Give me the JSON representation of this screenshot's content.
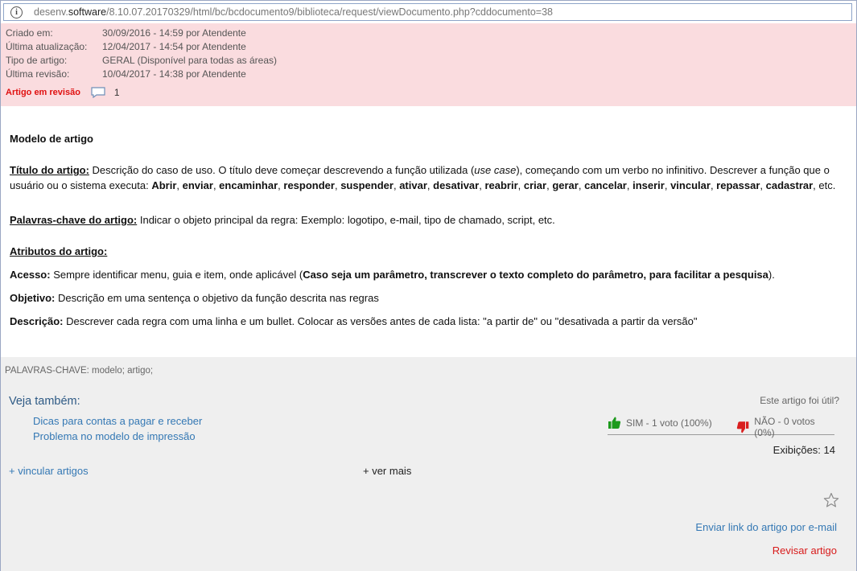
{
  "urlbar": {
    "prefix": "desenv.",
    "domain": "software",
    "path": "/8.10.07.20170329/html/bc/bcdocumento9/biblioteca/request/viewDocumento.php?cddocumento=38"
  },
  "meta": {
    "rows": [
      {
        "label": "Criado em:",
        "value": "30/09/2016 - 14:59 por Atendente"
      },
      {
        "label": "Última atualização:",
        "value": "12/04/2017 - 14:54 por Atendente"
      },
      {
        "label": "Tipo de artigo:",
        "value": "GERAL (Disponível para todas as áreas)"
      },
      {
        "label": "Última revisão:",
        "value": "10/04/2017 - 14:38 por Atendente"
      }
    ],
    "status": "Artigo em revisão",
    "comment_count": "1"
  },
  "article": {
    "heading": "Modelo de artigo",
    "titulo_label": "Título do artigo:",
    "titulo_p1": " Descrição do caso de uso. O título deve começar descrevendo a função utilizada (",
    "titulo_em": "use case",
    "titulo_p2": "), começando com um verbo no infinitivo. Descrever a função que o",
    "titulo_l2a": "usuário ou o sistema executa: ",
    "verbs": [
      "Abrir",
      "enviar",
      "encaminhar",
      "responder",
      "suspender",
      "ativar",
      "desativar",
      "reabrir",
      "criar",
      "gerar",
      "cancelar",
      "inserir",
      "vincular",
      "repassar",
      "cadastrar"
    ],
    "verbs_end": ", etc.",
    "palavras_label": "Palavras-chave do artigo:",
    "palavras_text": " Indicar o objeto principal da regra: Exemplo: logotipo, e-mail, tipo de chamado, script, etc.",
    "atributos_label": "Atributos do artigo:",
    "acesso_label": "Acesso:",
    "acesso_text": " Sempre identificar menu, guia e item, onde aplicável (",
    "acesso_bold": "Caso seja um parâmetro, transcrever o texto completo do parâmetro, para facilitar a pesquisa",
    "acesso_end": ").",
    "objetivo_label": "Objetivo:",
    "objetivo_text": " Descrição em uma sentença o objetivo da função descrita nas regras",
    "descricao_label": "Descrição:",
    "descricao_text": " Descrever cada regra com uma linha e um bullet. Colocar as versões antes de cada lista: \"a partir de\" ou \"desativada a partir da versão\""
  },
  "bottom": {
    "keywords": "PALAVRAS-CHAVE: modelo; artigo;",
    "see_also_title": "Veja também:",
    "related": [
      "Dicas para contas a pagar e receber",
      "Problema no modelo de impressão"
    ],
    "link_articles": "+ vincular artigos",
    "see_more": "+ ver mais",
    "helpful_question": "Este artigo foi útil?",
    "vote_yes": "SIM - 1 voto (100%)",
    "vote_no": "NÃO - 0 votos (0%)",
    "views": "Exibições: 14",
    "email_link": "Enviar link do artigo por e-mail",
    "review_link": "Revisar artigo"
  },
  "colors": {
    "status": "#e01010",
    "link": "#3478b4",
    "meta_bg": "#fadcdf",
    "yes": "#1c9a1c",
    "no": "#d91f1f"
  },
  "icons": [
    "info-icon",
    "comment-icon",
    "thumbs-up-icon",
    "thumbs-down-icon",
    "star-icon"
  ]
}
